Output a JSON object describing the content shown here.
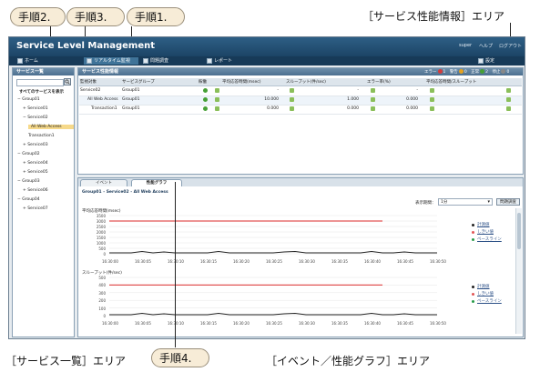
{
  "callouts": {
    "step2": "手順2.",
    "step3": "手順3.",
    "step1": "手順1.",
    "step4": "手順4."
  },
  "area_labels": {
    "performance_info": "［サービス性能情報］エリア",
    "service_list": "［サービス一覧］エリア",
    "event_graph": "［イベント／性能グラフ］エリア"
  },
  "app": {
    "title": "Service Level Management",
    "user": "super",
    "help": "ヘルプ",
    "logout": "ログアウト",
    "menu": {
      "home": "ホーム",
      "realtime": "リアルタイム監視",
      "problem": "問題調査",
      "report": "レポート",
      "settings": "設定"
    }
  },
  "service_list": {
    "title": "サービス一覧",
    "show_all": "すべてのサービスを表示",
    "tree": [
      "− Group01",
      "+ Service01",
      "− Service02",
      "All Web Access",
      "Transaction1",
      "+ Service03",
      "− Group02",
      "+ Service04",
      "+ Service05",
      "− Group03",
      "+ Service06",
      "− Group04",
      "+ Service07"
    ]
  },
  "performance": {
    "title": "サービス性能情報",
    "status": {
      "error": "エラー",
      "error_count": "1",
      "warning": "警告",
      "warning_count": "0",
      "normal": "正常",
      "normal_count": "2",
      "stopped": "停止",
      "stopped_count": "0"
    },
    "headers": [
      "監視対象",
      "サービスグループ",
      "稼働",
      "平均応答時間(msec)",
      "スループット(件/sec)",
      "エラー率(%)",
      "平均応答時間/スループット"
    ],
    "rows": [
      {
        "name": "Service02",
        "group": "Group01",
        "resp": "-",
        "thru": "-",
        "err": "-"
      },
      {
        "name": "All Web Access",
        "group": "Group01",
        "resp": "10.000",
        "thru": "1.000",
        "err": "0.000"
      },
      {
        "name": "Transaction1",
        "group": "Group01",
        "resp": "0.000",
        "thru": "0.000",
        "err": "0.000"
      }
    ]
  },
  "event_graph": {
    "tab_event": "イベント",
    "tab_graph": "性能グラフ",
    "breadcrumb": "Group01 - Service02 - All Web Access",
    "period_label": "表示期間：",
    "period_value": "1分",
    "problem_button": "問題調査",
    "charts": [
      {
        "title": "平均応答時間(msec)",
        "yticks": [
          "3500",
          "3000",
          "2500",
          "2000",
          "1500",
          "1000",
          "500",
          "0"
        ],
        "xticks": [
          "16:30:00",
          "16:30:05",
          "16:30:10",
          "16:30:15",
          "16:30:20",
          "16:30:25",
          "16:30:30",
          "16:30:35",
          "16:30:40",
          "16:30:45",
          "16:30:50"
        ],
        "legend": [
          "計測値",
          "しきい値",
          "ベースライン"
        ],
        "threshold_value": 3000,
        "baseline_value": 0,
        "ymax": 3500
      },
      {
        "title": "スループット(件/sec)",
        "yticks": [
          "500",
          "400",
          "300",
          "200",
          "100",
          "0"
        ],
        "xticks": [
          "16:30:00",
          "16:30:05",
          "16:30:10",
          "16:30:15",
          "16:30:20",
          "16:30:25",
          "16:30:30",
          "16:30:35",
          "16:30:40",
          "16:30:45",
          "16:30:50"
        ],
        "legend": [
          "計測値",
          "しきい値",
          "ベースライン"
        ],
        "threshold_value": 400,
        "baseline_value": 0,
        "ymax": 500
      }
    ]
  },
  "colors": {
    "measured": "#222222",
    "threshold": "#e25555",
    "baseline": "#2a9d4c",
    "header_blue": "#1c4466"
  }
}
